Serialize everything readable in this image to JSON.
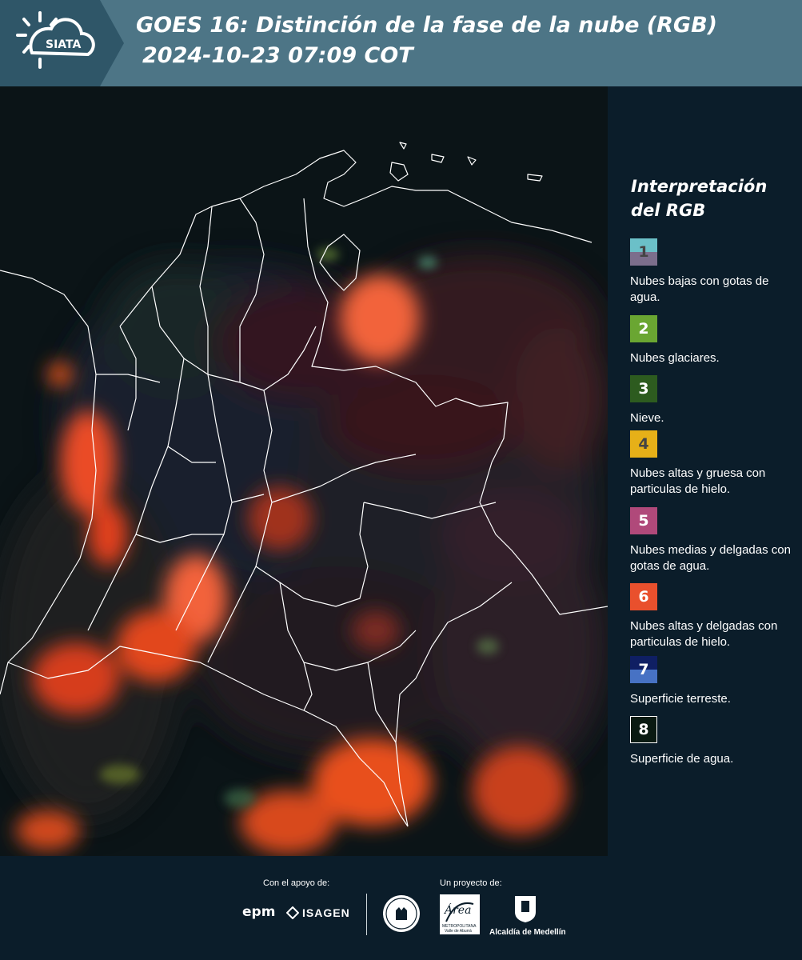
{
  "header": {
    "logo_text": "SIATA",
    "title_line1": "GOES 16: Distinción de la fase de la nube (RGB)",
    "title_line2": "2024-10-23 07:09 COT"
  },
  "legend": {
    "title": "Interpretación del RGB",
    "items": [
      {
        "number": "1",
        "label": "Nubes bajas con gotas de agua.",
        "color_top": "#6bc0c8",
        "color_bottom": "#7c6e8c",
        "number_color": "#444444"
      },
      {
        "number": "2",
        "label": "Nubes glaciares.",
        "color_top": "#6aa632",
        "color_bottom": "#6aa632",
        "number_color": "#ffffff"
      },
      {
        "number": "3",
        "label": "Nieve.",
        "color_top": "#2d5b1f",
        "color_bottom": "#2d5b1f",
        "number_color": "#ffffff"
      },
      {
        "number": "4",
        "label": "Nubes altas y gruesa con particulas de hielo.",
        "color_top": "#e6b018",
        "color_bottom": "#e6b018",
        "number_color": "#444444"
      },
      {
        "number": "5",
        "label": "Nubes medias y delgadas con gotas de agua.",
        "color_top": "#b0497a",
        "color_bottom": "#b0497a",
        "number_color": "#ffffff"
      },
      {
        "number": "6",
        "label": "Nubes altas y delgadas con particulas de hielo.",
        "color_top": "#e9502d",
        "color_bottom": "#e9502d",
        "number_color": "#ffffff"
      },
      {
        "number": "7",
        "label": "Superficie terreste.",
        "color_top": "#0f1f63",
        "color_bottom": "#4772c4",
        "number_color": "#ffffff"
      },
      {
        "number": "8",
        "label": "Superficie de agua.",
        "color_top": "#0a1a12",
        "color_bottom": "#0a1a12",
        "number_color": "#ffffff"
      }
    ]
  },
  "footer": {
    "support_label": "Con el apoyo de:",
    "project_label": "Un proyecto de:",
    "sponsor_epm": "epm",
    "sponsor_isagen": "ISAGEN",
    "area_text": "Área",
    "area_sub1": "METROPOLITANA",
    "area_sub2": "Valle de Aburrá",
    "alcaldia_text": "Alcaldía de Medellín"
  },
  "colors": {
    "header_bg": "#4d7586",
    "page_bg": "#0b1d2a",
    "cloud_orange": "#f05a2a",
    "border_lines": "#ffffff"
  }
}
